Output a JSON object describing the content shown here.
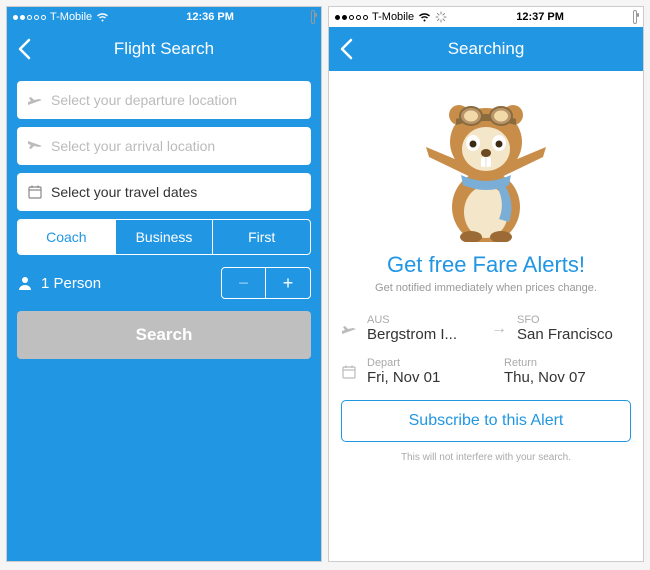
{
  "left": {
    "status": {
      "carrier": "T-Mobile",
      "time": "12:36 PM"
    },
    "nav": {
      "title": "Flight Search"
    },
    "departure_placeholder": "Select your departure location",
    "arrival_placeholder": "Select your arrival location",
    "dates_placeholder": "Select your travel dates",
    "cabin": {
      "options": [
        "Coach",
        "Business",
        "First"
      ],
      "selected": "Coach"
    },
    "persons": {
      "label": "1 Person"
    },
    "search_label": "Search"
  },
  "right": {
    "status": {
      "carrier": "T-Mobile",
      "time": "12:37 PM"
    },
    "nav": {
      "title": "Searching"
    },
    "headline": "Get free Fare Alerts!",
    "sub": "Get notified immediately when prices change.",
    "origin": {
      "code": "AUS",
      "name": "Bergstrom I..."
    },
    "dest": {
      "code": "SFO",
      "name": "San Francisco"
    },
    "depart": {
      "label": "Depart",
      "value": "Fri, Nov 01"
    },
    "return": {
      "label": "Return",
      "value": "Thu, Nov 07"
    },
    "subscribe_label": "Subscribe to this Alert",
    "foot": "This will not interfere with your search."
  }
}
